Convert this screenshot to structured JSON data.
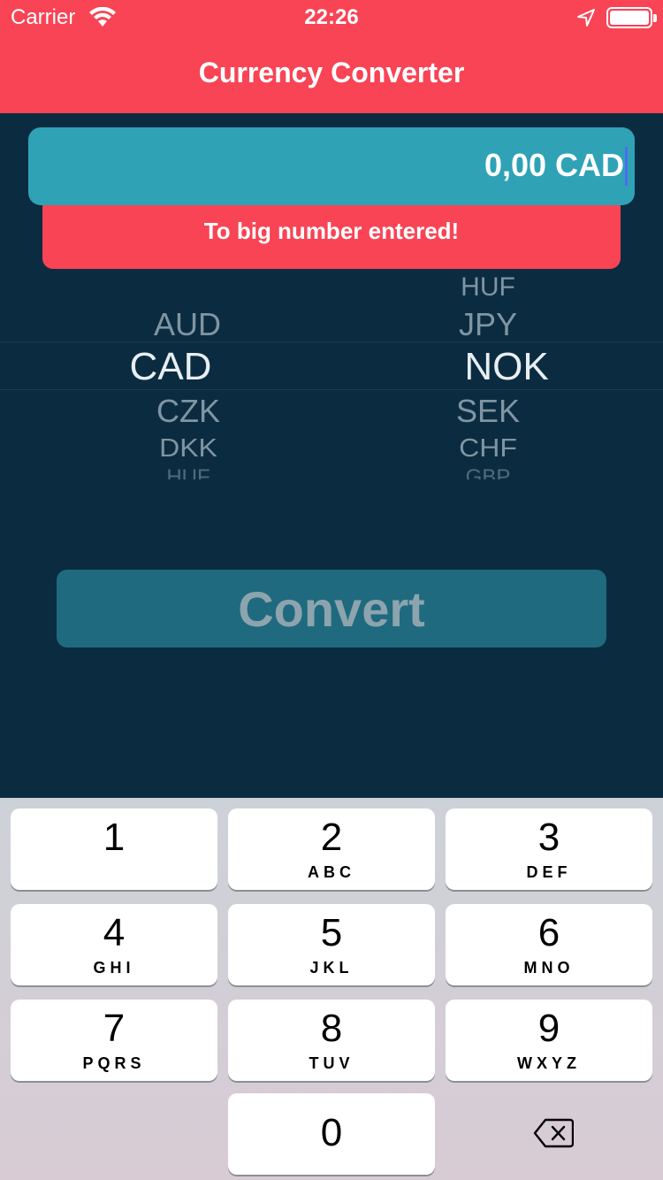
{
  "status_bar": {
    "carrier": "Carrier",
    "time": "22:26"
  },
  "nav": {
    "title": "Currency Converter"
  },
  "amount_field": {
    "value": "0,00 CAD"
  },
  "error": {
    "message": "To big number entered!"
  },
  "picker_from": {
    "selected": "CAD",
    "items": [
      "AUD",
      "CAD",
      "CZK",
      "DKK",
      "HUF"
    ]
  },
  "picker_to": {
    "selected": "NOK",
    "items": [
      "HUF",
      "JPY",
      "NOK",
      "SEK",
      "CHF",
      "GBP"
    ]
  },
  "convert_button": {
    "label": "Convert"
  },
  "keypad": {
    "keys": [
      {
        "num": "1",
        "letters": ""
      },
      {
        "num": "2",
        "letters": "ABC"
      },
      {
        "num": "3",
        "letters": "DEF"
      },
      {
        "num": "4",
        "letters": "GHI"
      },
      {
        "num": "5",
        "letters": "JKL"
      },
      {
        "num": "6",
        "letters": "MNO"
      },
      {
        "num": "7",
        "letters": "PQRS"
      },
      {
        "num": "8",
        "letters": "TUV"
      },
      {
        "num": "9",
        "letters": "WXYZ"
      },
      {
        "num": "0",
        "letters": ""
      }
    ]
  },
  "colors": {
    "nav_red": "#f84455",
    "background_navy": "#0b2c40",
    "field_teal": "#2fa2b6",
    "button_teal": "#1f6a7e"
  }
}
